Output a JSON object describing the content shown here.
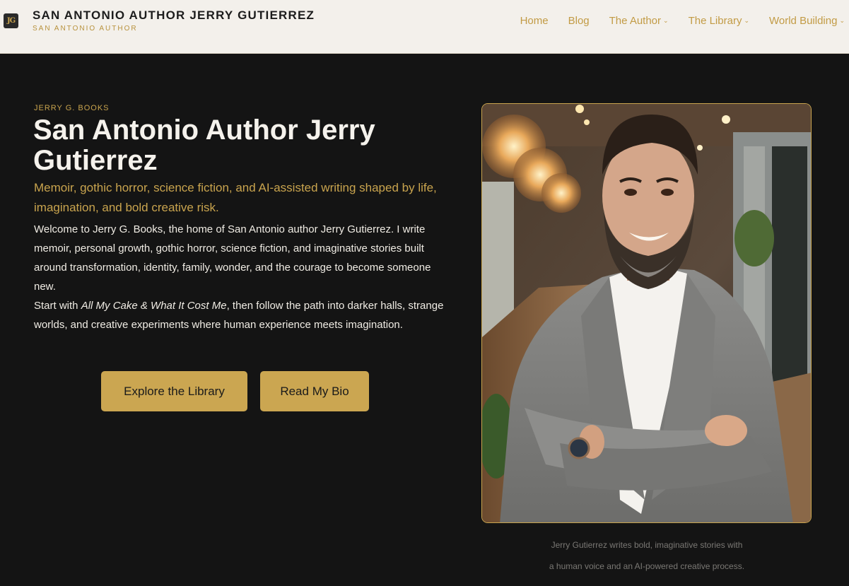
{
  "header": {
    "logo_text": "JG",
    "site_title": "SAN ANTONIO AUTHOR JERRY GUTIERREZ",
    "site_tagline": "SAN ANTONIO AUTHOR"
  },
  "nav": {
    "home": "Home",
    "blog": "Blog",
    "author": "The Author",
    "library": "The Library",
    "world": "World Building",
    "dropdown_icon": "chevron-down-icon"
  },
  "hero": {
    "eyebrow": "JERRY G. BOOKS",
    "title": "San Antonio Author Jerry Gutierrez",
    "subtitle": "Memoir, gothic horror, science fiction, and AI-assisted writing shaped by life, imagination, and bold creative risk.",
    "paragraph1": "Welcome to Jerry G. Books, the home of San Antonio author Jerry Gutierrez. I write memoir, personal growth, gothic horror, science fiction, and imaginative stories built around transformation, identity, family, wonder, and the courage to become someone new.",
    "paragraph2_prefix": "Start with ",
    "paragraph2_book": "All My Cake & What It Cost Me",
    "paragraph2_suffix": ", then follow the path into darker halls, strange worlds, and creative experiments where human experience meets imagination.",
    "btn_library": "Explore the Library",
    "btn_bio": "Read My Bio"
  },
  "photo": {
    "caption_line1": "Jerry Gutierrez writes bold, imaginative stories with",
    "caption_line2": "a human voice and an AI-powered creative process."
  },
  "colors": {
    "accent": "#c9a44e",
    "background": "#141414",
    "header_bg": "#f3f0eb"
  }
}
